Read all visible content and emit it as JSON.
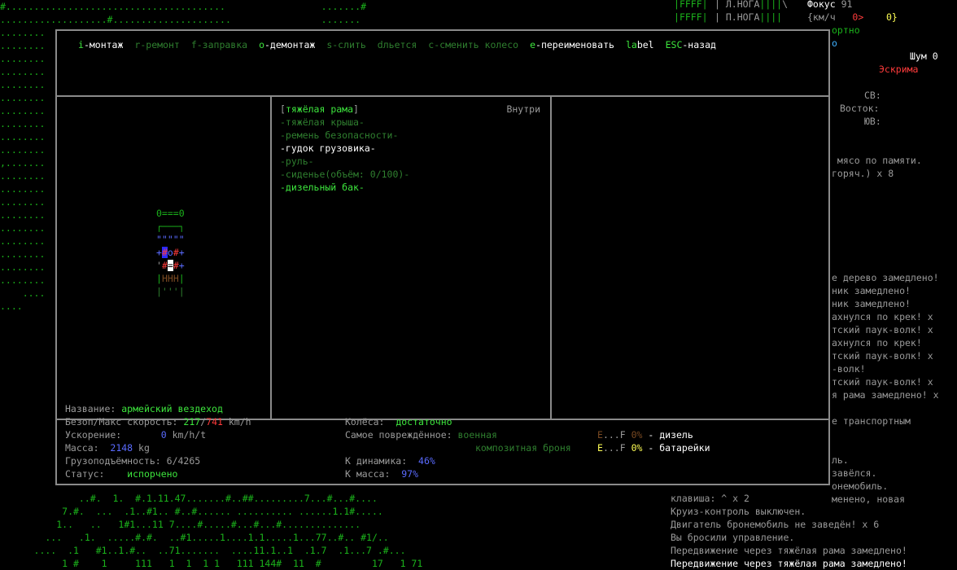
{
  "map_top": [
    "#.......................................                 .......#",
    "...................#.....................                ......."
  ],
  "map_left": [
    "........",
    "........",
    "........",
    "........",
    "........",
    "........",
    "........",
    "........",
    "........",
    "........",
    ",.......",
    "........",
    "........",
    "........",
    "........",
    "........",
    "........",
    "........",
    "........",
    "........",
    "    ....",
    "...."
  ],
  "map_bottom": [
    "              ..#.  1.  #.1.11.47.......#..##.........7...#...#....",
    "           7.#.  ...  .1..#1.. #..#...... .......... ......1.1#.....",
    "          1..   ..   1#1...11 7....#.....#...#...#..............",
    "        ...   .1.  .....#.#.  ..#1.....1....1.1.....1...77..#.. #1/..",
    "      ....  .1   #1..1.#..  ..71.......  ....11.1..1  .1.7  .1...7 .#...",
    "           1 #    1     111   1  1  1 1   111 144#  11  #         17   1 71"
  ],
  "right_panel": {
    "bars": [
      "FFFF",
      "FFFF"
    ],
    "left_leg": "Л.НОГА",
    "right_leg": "П.НОГА",
    "leg_bars": "||||",
    "focus_label": "Фокус",
    "focus_value": "91",
    "speed_unit": "{км/ч",
    "speed_a": "0>",
    "speed_b": "0}",
    "fragment": "ортно",
    "fragment2": "о",
    "noise_label": "Шум",
    "noise_value": "0",
    "style": "Эскрима",
    "dir_ne": "СВ:",
    "dir_e": "Восток:",
    "dir_se": "ЮВ:",
    "log": [
      " мясо по памяти.",
      "горяч.) x 8",
      "",
      "",
      "",
      "",
      "",
      "",
      "",
      "е дерево замедлено!",
      "ник замедлено!",
      "ник замедлено!",
      "ахнулся по крек! x",
      "тский паук-волк! x",
      "ахнулся по крек!",
      "тский паук-волк! x",
      "-волк!",
      "тский паук-волк! x",
      "я рама замедлено! x",
      "",
      "е транспортным",
      "",
      "",
      "ль.",
      "завёлся.",
      "онемобиль.",
      "менено, новая"
    ]
  },
  "message_log": [
    "клавиша: ^ x 2",
    "Круиз-контроль выключен.",
    "Двигатель бронемобиль не заведён! x 6",
    "Вы бросили управление.",
    "Передвижение через тяжёлая рама замедлено!",
    "Передвижение через тяжёлая рама замедлено!"
  ],
  "menu": [
    {
      "key": "i",
      "text": "-монтаж",
      "enabled": true
    },
    {
      "key": "r",
      "text": "-ремонт",
      "enabled": false
    },
    {
      "key": "f",
      "text": "-заправка",
      "enabled": false
    },
    {
      "key": "o",
      "text": "-демонтаж",
      "enabled": true
    },
    {
      "key": "s",
      "text": "-слить",
      "enabled": false
    },
    {
      "key": "d",
      "text": "льется",
      "enabled": false
    },
    {
      "key": "c",
      "text": "-сменить колесо",
      "enabled": false
    },
    {
      "key": "e",
      "text": "-переименовать",
      "enabled": true
    },
    {
      "key": "la",
      "text": "bel",
      "enabled": true,
      "key_after": true
    },
    {
      "key": "ESC",
      "text": "-назад",
      "enabled": true
    }
  ],
  "parts": {
    "location": "Внутри",
    "items": [
      {
        "label": "[тяжёлая рама]",
        "state": "selected"
      },
      {
        "label": "-тяжёлая крыша-",
        "state": "dim"
      },
      {
        "label": "-ремень безопасности-",
        "state": "dim"
      },
      {
        "label": "-гудок грузовика-",
        "state": "white"
      },
      {
        "label": "-руль-",
        "state": "dim"
      },
      {
        "label": "-сиденье(объём: 0/100)-",
        "state": "dim"
      },
      {
        "label": "-дизельный бак-",
        "state": "bright"
      }
    ]
  },
  "vehicle_ascii": [
    {
      "t": "0===0",
      "c": "g"
    },
    {
      "t": "┌───┐",
      "c": "g"
    },
    {
      "t": "\"\"\"\"\"",
      "c": "b"
    },
    {
      "t": "+#o#+",
      "c": "mix1"
    },
    {
      "t": "'#=#+",
      "c": "mix2"
    },
    {
      "t": "|HHH|",
      "c": "mix3"
    },
    {
      "t": "|'''|",
      "c": "dg"
    }
  ],
  "info": {
    "name_label": "Название:",
    "name_value": "армейский вездеход",
    "speed_label": "Безоп/Макс скорость:",
    "speed_safe": "217",
    "speed_max": "741",
    "speed_unit": "km/h",
    "accel_label": "Ускорение:",
    "accel_value": "0",
    "accel_unit": "km/h/t",
    "mass_label": "Масса:",
    "mass_value": "2148",
    "mass_unit": "kg",
    "cargo_label": "Грузоподъёмность:",
    "cargo_value": "6/4265",
    "status_label": "Статус:",
    "status_value": "испорчено",
    "wheels_label": "Колёса:",
    "wheels_value": "достаточно",
    "damaged_label": "Самое повреждённое:",
    "damaged_value_1": "военная",
    "damaged_value_2": "композитная броня",
    "dyn_label": "К динамика:",
    "dyn_value": "46%",
    "kmass_label": "К масса:",
    "kmass_value": "97%",
    "fuel_1_gauge_e": "E",
    "fuel_1_gauge_mid": "...F",
    "fuel_1_pct": "0%",
    "fuel_1_name": "- дизель",
    "fuel_2_gauge_e": "E",
    "fuel_2_gauge_mid": "...F",
    "fuel_2_pct": "0%",
    "fuel_2_name": "- батарейки"
  },
  "colors": {
    "map_green": "#1bb31b",
    "bright_green": "#3de63d",
    "dim_green": "#2f7f2f",
    "red": "#ff3b3b",
    "blue": "#5a6bff",
    "border": "#8a8a8a"
  }
}
